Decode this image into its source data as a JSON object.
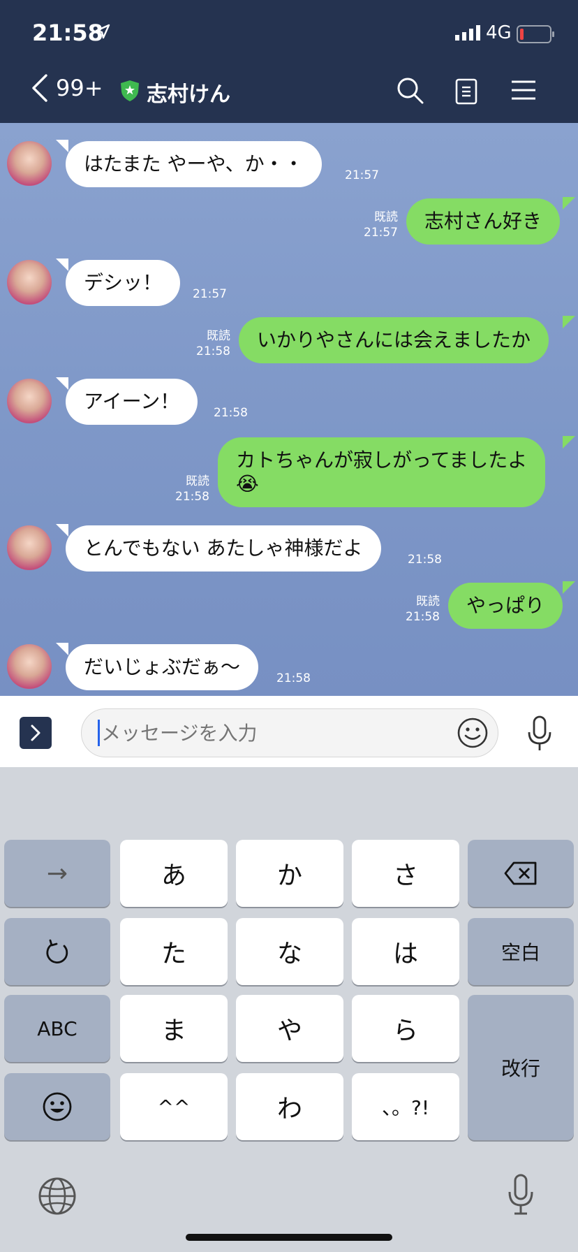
{
  "status": {
    "time": "21:58",
    "network": "4G"
  },
  "header": {
    "back_count": "99+",
    "title": "志村けん"
  },
  "messages": [
    {
      "side": "in",
      "text": "はたまた やーや、か・・",
      "time": "21:57"
    },
    {
      "side": "out",
      "text": "志村さん好き",
      "read": "既読",
      "time": "21:57"
    },
    {
      "side": "in",
      "text": "デシッ！",
      "time": "21:57"
    },
    {
      "side": "out",
      "text": "いかりやさんには会えましたか",
      "read": "既読",
      "time": "21:58"
    },
    {
      "side": "in",
      "text": "アイーン！",
      "time": "21:58"
    },
    {
      "side": "out",
      "text": "カトちゃんが寂しがってましたよ",
      "text2": "😭",
      "read": "既読",
      "time": "21:58"
    },
    {
      "side": "in",
      "text": "とんでもない あたしゃ神様だよ",
      "time": "21:58"
    },
    {
      "side": "out",
      "text": "やっぱり",
      "read": "既読",
      "time": "21:58"
    },
    {
      "side": "in",
      "text": "だいじょぶだぁ～",
      "time": "21:58"
    }
  ],
  "input": {
    "placeholder": "メッセージを入力"
  },
  "keyboard": {
    "row1": [
      "→",
      "あ",
      "か",
      "さ"
    ],
    "row2": [
      "た",
      "な",
      "は",
      "空白"
    ],
    "row3": [
      "ABC",
      "ま",
      "や",
      "ら"
    ],
    "row4": [
      "^^",
      "わ",
      "、。?!"
    ],
    "enter": "改行"
  }
}
